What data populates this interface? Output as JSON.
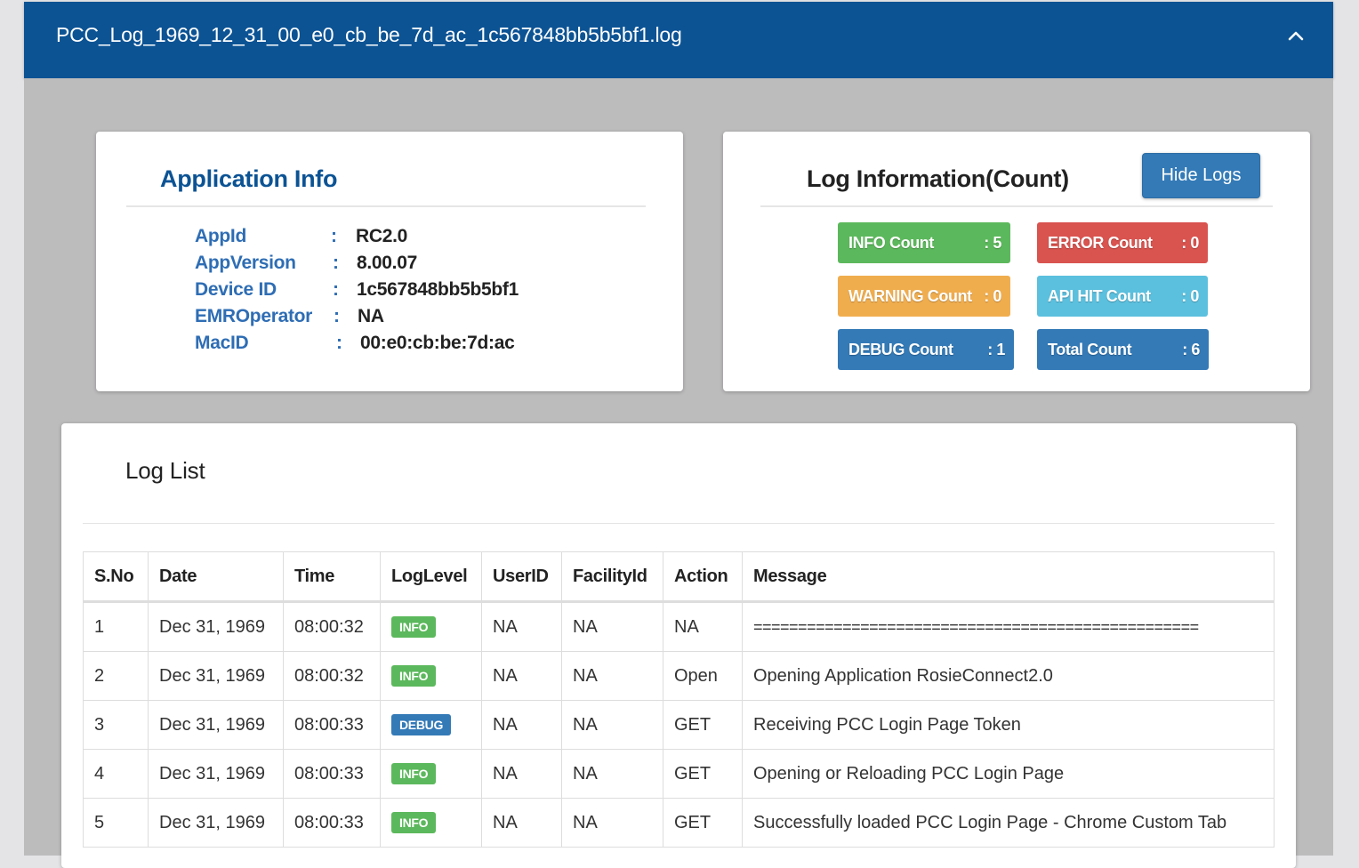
{
  "header": {
    "title": "PCC_Log_1969_12_31_00_e0_cb_be_7d_ac_1c567848bb5b5bf1.log",
    "toggle_icon": "chevron-up-icon"
  },
  "app_info": {
    "title": "Application Info",
    "separator": ":",
    "rows": [
      {
        "key": "AppId",
        "value": "RC2.0"
      },
      {
        "key": "AppVersion",
        "value": "8.00.07"
      },
      {
        "key": "Device ID",
        "value": "1c567848bb5b5bf1"
      },
      {
        "key": "EMROperator",
        "value": "NA"
      },
      {
        "key": "MacID",
        "value": "00:e0:cb:be:7d:ac"
      }
    ]
  },
  "log_info": {
    "title": "Log Information(Count)",
    "hide_button": "Hide Logs",
    "counts": [
      {
        "label": "INFO Count",
        "value": ": 5",
        "color": "#5cb85c"
      },
      {
        "label": "ERROR Count",
        "value": ": 0",
        "color": "#d9534f"
      },
      {
        "label": "WARNING Count",
        "value": ": 0",
        "color": "#f0ad4e"
      },
      {
        "label": "API HIT Count",
        "value": ": 0",
        "color": "#5bc0de"
      },
      {
        "label": "DEBUG Count",
        "value": ": 1",
        "color": "#337ab7"
      },
      {
        "label": "Total Count",
        "value": ": 6",
        "color": "#337ab7"
      }
    ]
  },
  "log_list": {
    "title": "Log List",
    "columns": [
      "S.No",
      "Date",
      "Time",
      "LogLevel",
      "UserID",
      "FacilityId",
      "Action",
      "Message"
    ],
    "rows": [
      {
        "sno": "1",
        "date": "Dec 31, 1969",
        "time": "08:00:32",
        "level": "INFO",
        "user": "NA",
        "facility": "NA",
        "action": "NA",
        "message": "=================================================="
      },
      {
        "sno": "2",
        "date": "Dec 31, 1969",
        "time": "08:00:32",
        "level": "INFO",
        "user": "NA",
        "facility": "NA",
        "action": "Open",
        "message": "Opening Application RosieConnect2.0"
      },
      {
        "sno": "3",
        "date": "Dec 31, 1969",
        "time": "08:00:33",
        "level": "DEBUG",
        "user": "NA",
        "facility": "NA",
        "action": "GET",
        "message": "Receiving PCC Login Page Token"
      },
      {
        "sno": "4",
        "date": "Dec 31, 1969",
        "time": "08:00:33",
        "level": "INFO",
        "user": "NA",
        "facility": "NA",
        "action": "GET",
        "message": "Opening or Reloading PCC Login Page"
      },
      {
        "sno": "5",
        "date": "Dec 31, 1969",
        "time": "08:00:33",
        "level": "INFO",
        "user": "NA",
        "facility": "NA",
        "action": "GET",
        "message": "Successfully loaded PCC Login Page - Chrome Custom Tab"
      }
    ]
  }
}
